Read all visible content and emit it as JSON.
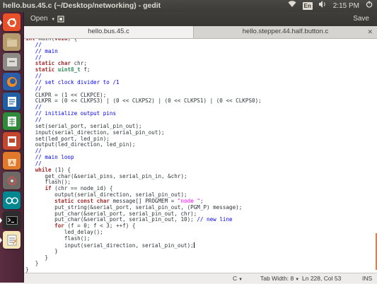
{
  "window": {
    "title": "hello.bus.45.c (~/Desktop/networking) - gedit"
  },
  "tray": {
    "keyboard": "En",
    "clock": "2:15 PM"
  },
  "header": {
    "open_label": "Open",
    "save_label": "Save"
  },
  "tabs": [
    {
      "label": "hello.bus.45.c"
    },
    {
      "label": "hello.stepper.44.half.button.c"
    }
  ],
  "editor": {
    "lines": [
      "int main(void) {",
      "   //",
      "   // main",
      "   //",
      "   static char chr;",
      "   static uint8_t f;",
      "   //",
      "   // set clock divider to /1",
      "   //",
      "   CLKPR = (1 << CLKPCE);",
      "   CLKPR = (0 << CLKPS3) | (0 << CLKPS2) | (0 << CLKPS1) | (0 << CLKPS0);",
      "   //",
      "   // initialize output pins",
      "   //",
      "   set(serial_port, serial_pin_out);",
      "   input(serial_direction, serial_pin_out);",
      "   set(led_port, led_pin);",
      "   output(led_direction, led_pin);",
      "   //",
      "   // main loop",
      "   //",
      "   while (1) {",
      "      get_char(&serial_pins, serial_pin_in, &chr);",
      "      flash();",
      "      if (chr == node_id) {",
      "         output(serial_direction, serial_pin_out);",
      "         static const char message[] PROGMEM = \"node \";",
      "         put_string(&serial_port, serial_pin_out, (PGM_P) message);",
      "         put_char(&serial_port, serial_pin_out, chr);",
      "         put_char(&serial_port, serial_pin_out, 10); // new line",
      "         for (f = 0; f < 3; ++f) {",
      "            led_delay();",
      "            flash();",
      "            input(serial_direction, serial_pin_out);",
      "         }",
      "      }",
      "   }",
      "}"
    ]
  },
  "status": {
    "language": "C",
    "tab_width": "Tab Width: 8",
    "position": "Ln 228, Col 53",
    "mode": "INS"
  },
  "colors": {
    "keyword": "#a52a2a",
    "type": "#2e8b57",
    "comment": "#0000ff",
    "string": "#ff00ff",
    "launcher": "#4a2436",
    "panel": "#3c3b37"
  },
  "launcher_icons": [
    "ubuntu-dash-icon",
    "files-icon",
    "file-manager-icon",
    "firefox-icon",
    "writer-icon",
    "calc-icon",
    "impress-icon",
    "software-center-icon",
    "settings-icon",
    "arduino-icon",
    "terminal-icon",
    "gedit-icon"
  ]
}
